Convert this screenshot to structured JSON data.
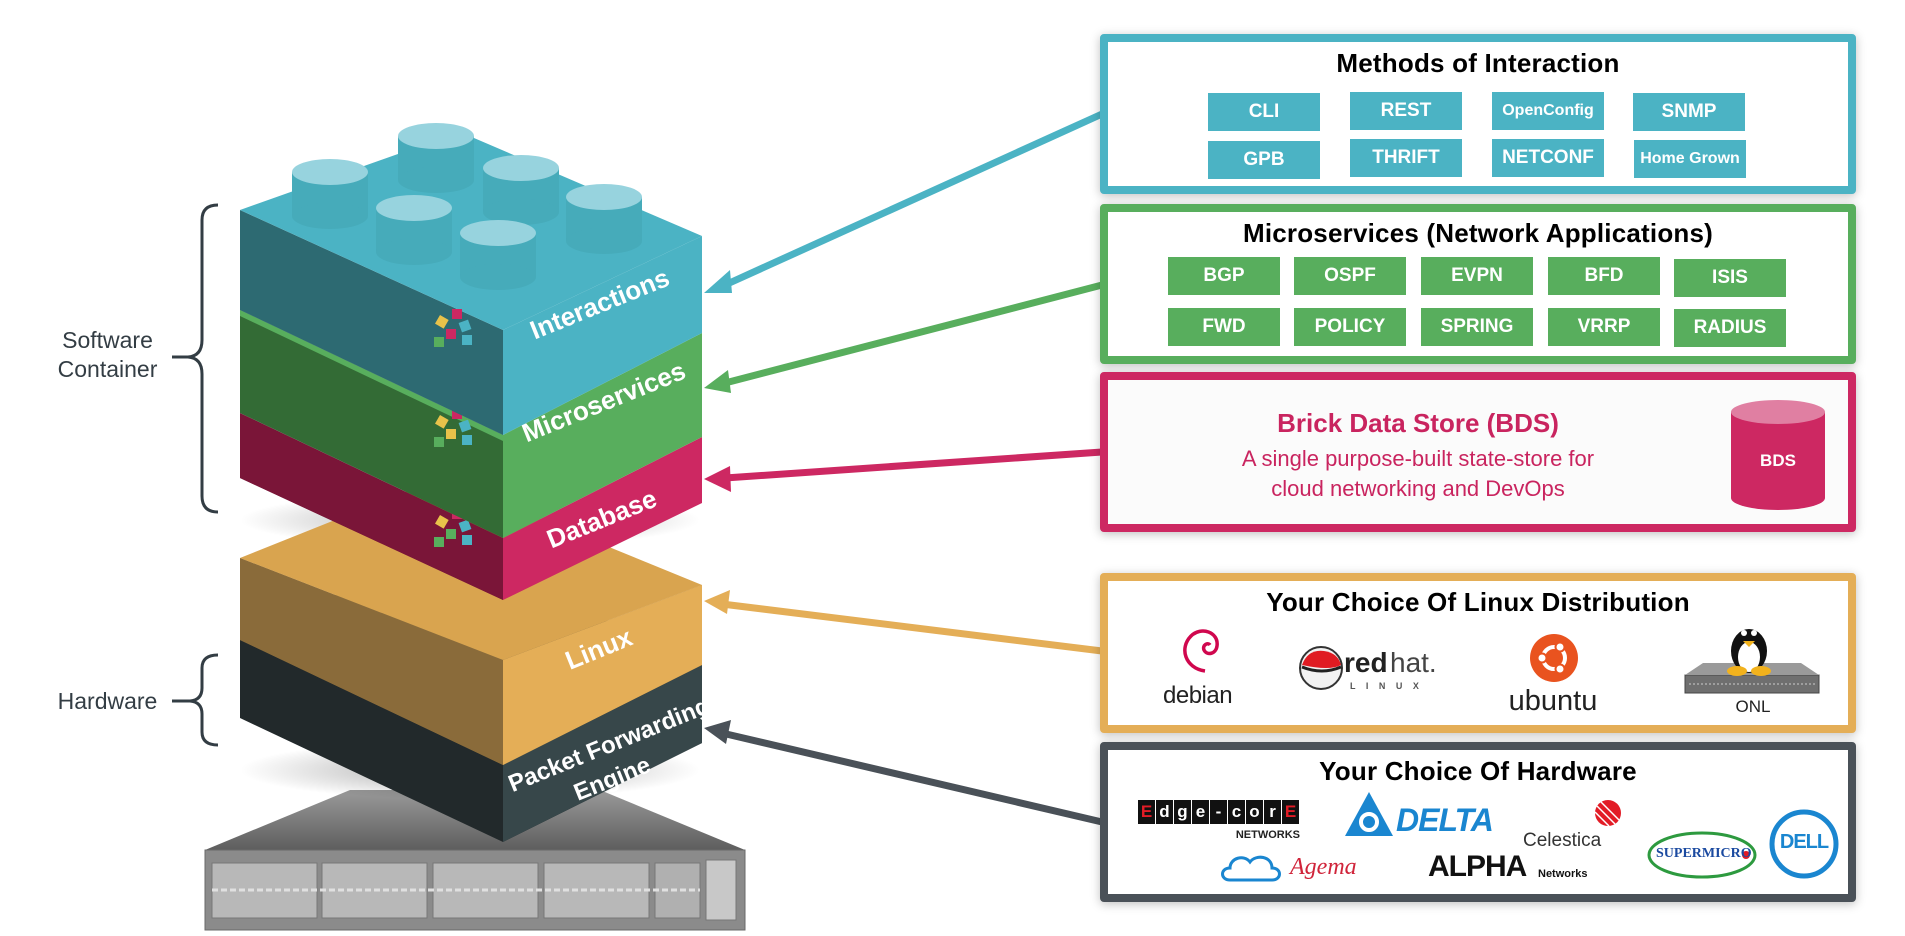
{
  "left": {
    "brace_labels": {
      "software": "Software\nContainer",
      "software_line1": "Software",
      "software_line2": "Container",
      "hardware": "Hardware"
    },
    "layers": [
      {
        "key": "interactions",
        "label": "Interactions",
        "color": "#4bb3c4"
      },
      {
        "key": "microservices",
        "label": "Microservices",
        "color": "#58ae5d"
      },
      {
        "key": "database",
        "label": "Database",
        "color": "#cd2862"
      },
      {
        "key": "linux",
        "label": "Linux",
        "color": "#e4ae57"
      },
      {
        "key": "pfe",
        "label_line1": "Packet Forwarding",
        "label_line2": "Engine",
        "color": "#37474a"
      }
    ]
  },
  "panels": {
    "interaction": {
      "title": "Methods of Interaction",
      "color": "#4bb3c4",
      "items": [
        "CLI",
        "REST",
        "OpenConfig",
        "SNMP",
        "GPB",
        "THRIFT",
        "NETCONF",
        "Home Grown"
      ]
    },
    "microservices": {
      "title": "Microservices (Network Applications)",
      "color": "#58ae5d",
      "items": [
        "BGP",
        "OSPF",
        "EVPN",
        "BFD",
        "ISIS",
        "FWD",
        "POLICY",
        "SPRING",
        "VRRP",
        "RADIUS"
      ]
    },
    "bds": {
      "title": "Brick Data Store (BDS)",
      "subtitle_line1": "A single purpose-built state-store for",
      "subtitle_line2": "cloud networking and DevOps",
      "cylinder_label": "BDS",
      "color": "#cd2862"
    },
    "linux": {
      "title": "Your Choice Of Linux Distribution",
      "color": "#e4ae57",
      "logos": {
        "debian": "debian",
        "redhat_main": "red",
        "redhat_hat": "hat.",
        "redhat_sub": "L I N U X",
        "ubuntu": "ubuntu",
        "onl": "ONL"
      }
    },
    "hardware": {
      "title": "Your Choice Of Hardware",
      "color": "#4a5158",
      "logos": {
        "edgecore_letters": [
          "E",
          "d",
          "g",
          "e",
          "-",
          "c",
          "o",
          "r",
          "E"
        ],
        "edgecore_sub": "NETWORKS",
        "delta": "DELTA",
        "celestica": "Celestica",
        "supermicro": "SUPERMICRO",
        "dell": "DELL",
        "agema": "Agema",
        "alpha": "ALPHA",
        "alpha_sub": "Networks"
      }
    }
  }
}
